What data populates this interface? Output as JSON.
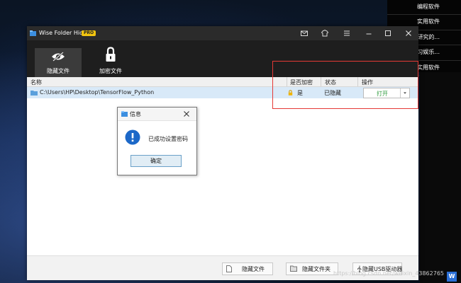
{
  "desktop": {
    "menu_items": [
      "编程软件",
      "实用软件",
      "研究的...",
      "习娱乐...",
      "实用软件"
    ]
  },
  "window": {
    "title": "Wise Folder Hider",
    "badge": "PRO",
    "title_icons": [
      "mail-icon",
      "shirt-icon",
      "menu-icon",
      "minimize-icon",
      "maximize-icon",
      "close-icon"
    ]
  },
  "toolbar": {
    "hide_files": "隐藏文件",
    "encrypt_files": "加密文件"
  },
  "table": {
    "headers": {
      "name": "名称",
      "encrypted": "是否加密",
      "status": "状态",
      "action": "操作"
    },
    "rows": [
      {
        "path": "C:\\Users\\HP\\Desktop\\TensorFlow_Python",
        "encrypted": "是",
        "status": "已隐藏",
        "action": "打开"
      }
    ]
  },
  "bottom": {
    "hide_file": "隐藏文件",
    "hide_folder": "隐藏文件夹",
    "hide_usb": "隐藏USB驱动器"
  },
  "dialog": {
    "title": "信息",
    "message": "已成功设置密码",
    "ok": "确定"
  },
  "watermark": "https://blog.csdn.net/weixin_43862765",
  "colors": {
    "accent": "#e53935",
    "open_green": "#2e9a3d",
    "row_selected": "#d8e9f8"
  }
}
